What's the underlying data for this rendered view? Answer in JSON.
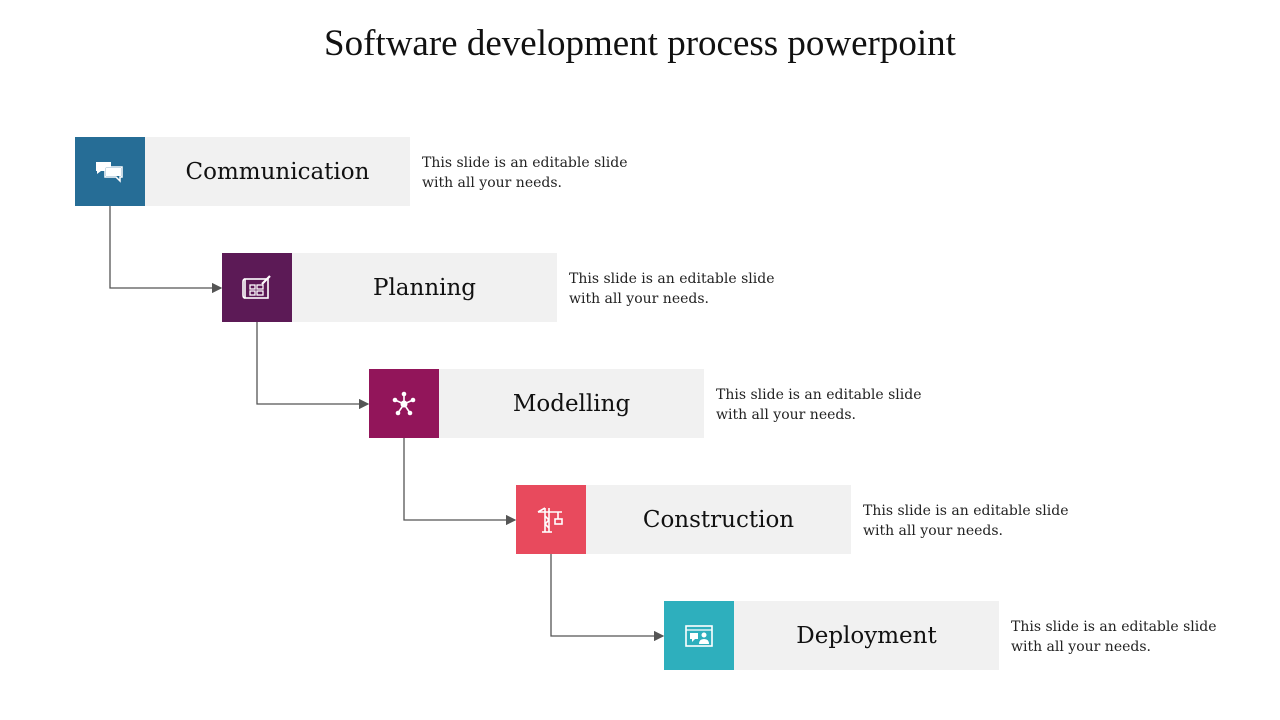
{
  "title": "Software development process powerpoint",
  "steps": [
    {
      "label": "Communication",
      "description_line1": "This slide is an editable slide",
      "description_line2": "with all your needs.",
      "icon": "chat-bubbles-icon",
      "color": "#266d96"
    },
    {
      "label": "Planning",
      "description_line1": "This slide is an editable slide",
      "description_line2": "with all your needs.",
      "icon": "blueprint-icon",
      "color": "#5c1a56"
    },
    {
      "label": "Modelling",
      "description_line1": "This slide is an editable slide",
      "description_line2": "with all your needs.",
      "icon": "network-node-icon",
      "color": "#92155a"
    },
    {
      "label": "Construction",
      "description_line1": "This slide is an editable slide",
      "description_line2": "with all your needs.",
      "icon": "crane-icon",
      "color": "#e84a5d"
    },
    {
      "label": "Deployment",
      "description_line1": "This slide is an editable slide",
      "description_line2": "with all your needs.",
      "icon": "presentation-window-icon",
      "color": "#2eafbd"
    }
  ],
  "connector_color": "#555555",
  "label_bg_color": "#f1f1f1"
}
